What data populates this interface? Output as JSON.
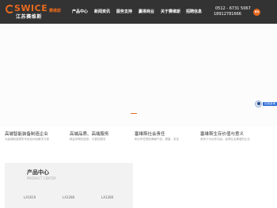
{
  "header": {
    "logo": {
      "wordmark": "SWICE",
      "company_name": "江苏赛维斯"
    },
    "slogan": "赛维斯",
    "nav": [
      {
        "label": "产品中心"
      },
      {
        "label": "新闻资讯"
      },
      {
        "label": "服务支持"
      },
      {
        "label": "赢得商业"
      },
      {
        "label": "关于赛维斯"
      },
      {
        "label": "招聘信息"
      }
    ],
    "phones": [
      "0512 - 6731 5067",
      "18912781666"
    ],
    "language": "EN"
  },
  "service_widget": {
    "label": "在线咨询"
  },
  "features": [
    {
      "title": "高端智能装备制造企业",
      "desc": "为高端制造提供专用自动化解决方案"
    },
    {
      "title": "高端品质、高端服务",
      "desc": "精益求精的品质，可靠的服务"
    },
    {
      "title": "塞维斯社会责任",
      "desc": "明示责任理念奉献产品，健康、安全"
    },
    {
      "title": "塞维斯生存价值与意义",
      "desc": "竞争力与伙伴共赢，赢得社会尊重的企业"
    }
  ],
  "products": {
    "title": "产品中心",
    "subtitle": "PRODUCT CENTER",
    "models": [
      "LA1610",
      "LA1280",
      "LA1280"
    ]
  },
  "colors": {
    "header_bg": "#333333",
    "accent": "#e86a1e",
    "service_blue": "#2f6fd8",
    "panel_bg": "#f2f2f2"
  }
}
